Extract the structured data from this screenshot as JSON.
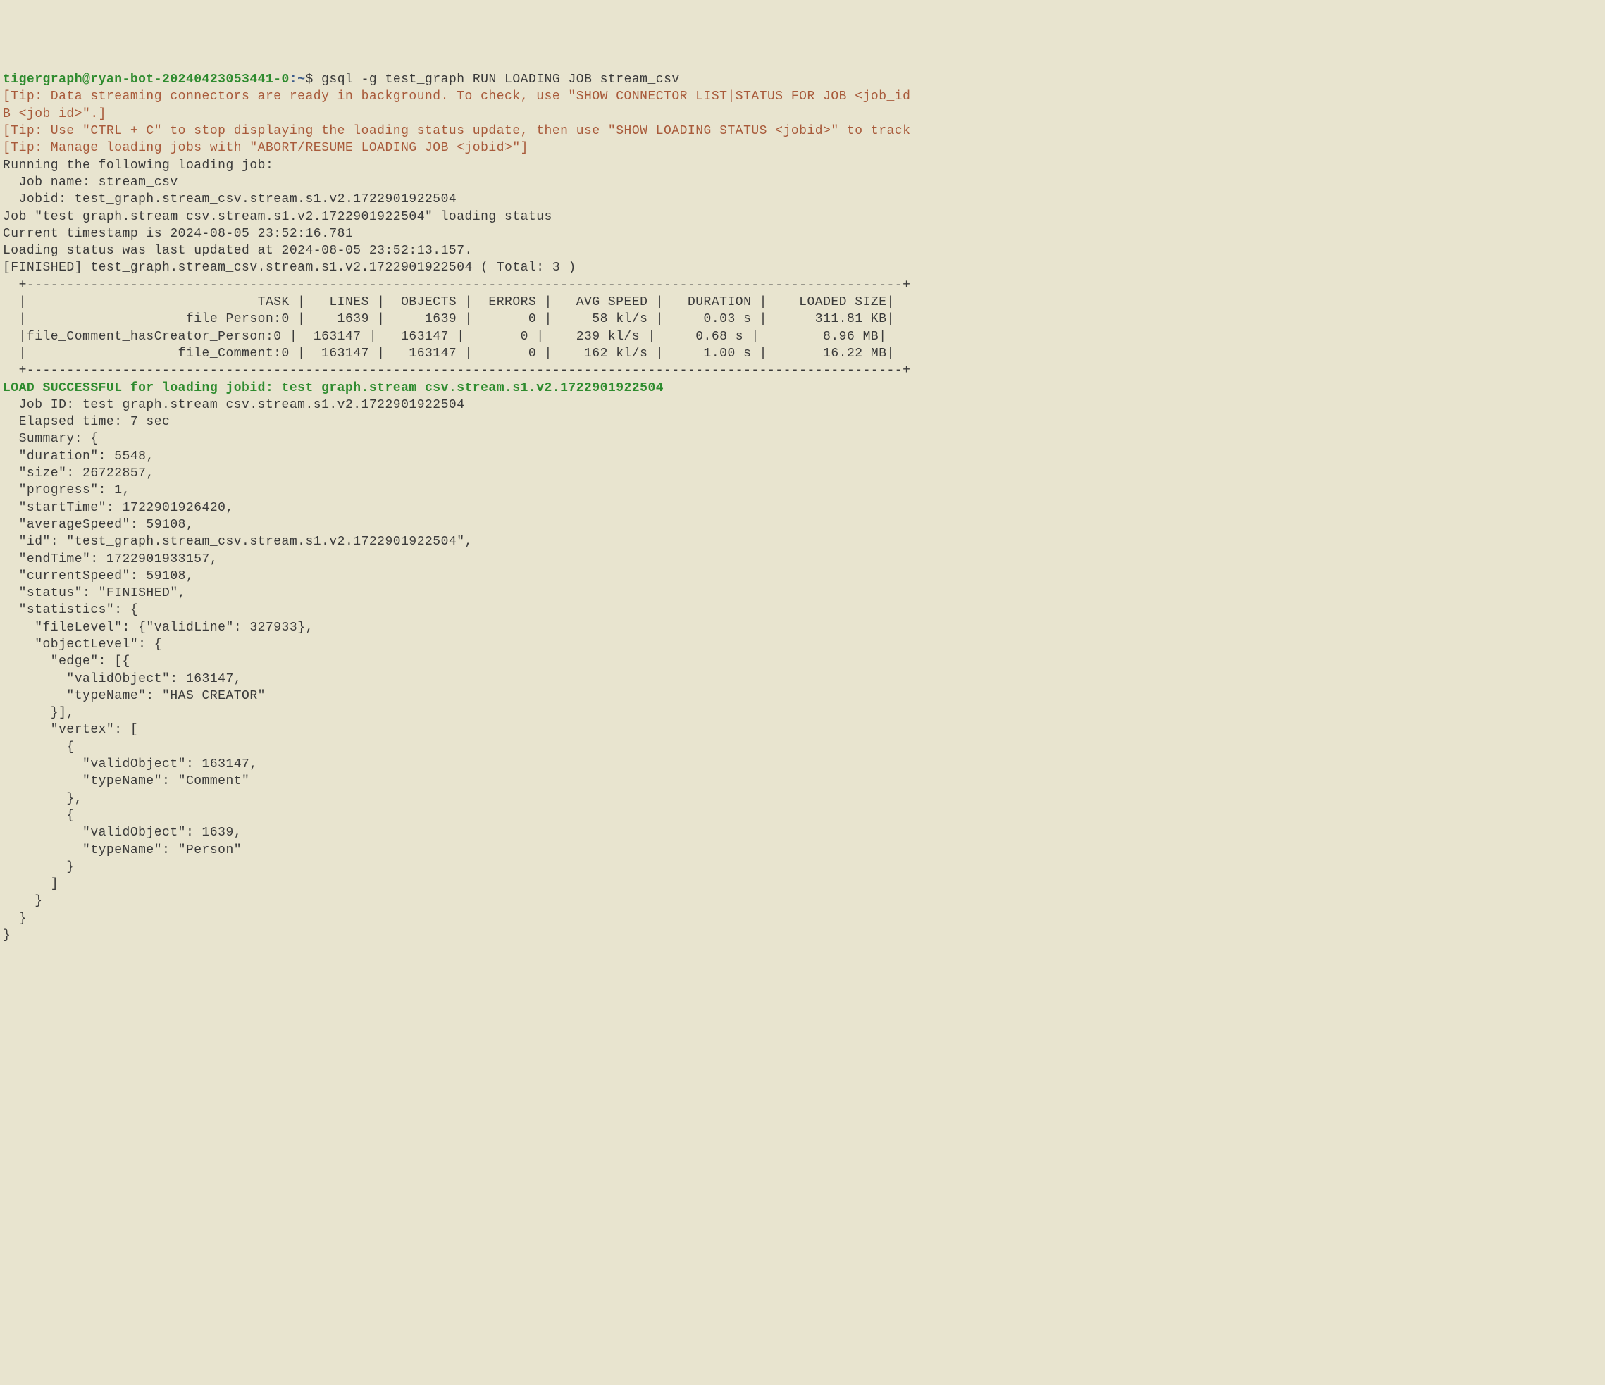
{
  "prompt": {
    "user": "tigergraph@ryan-bot-20240423053441-0",
    "separator": ":",
    "path": "~",
    "dollar": "$ "
  },
  "command": "gsql -g test_graph RUN LOADING JOB stream_csv",
  "tips": {
    "line1": "[Tip: Data streaming connectors are ready in background. To check, use \"SHOW CONNECTOR LIST|STATUS FOR JOB <job_id",
    "line2": "B <job_id>\".]",
    "line3": "[Tip: Use \"CTRL + C\" to stop displaying the loading status update, then use \"SHOW LOADING STATUS <jobid>\" to track",
    "line4": "[Tip: Manage loading jobs with \"ABORT/RESUME LOADING JOB <jobid>\"]"
  },
  "running": {
    "header": "Running the following loading job:",
    "jobname": "  Job name: stream_csv",
    "jobid": "  Jobid: test_graph.stream_csv.stream.s1.v2.1722901922504",
    "status": "Job \"test_graph.stream_csv.stream.s1.v2.1722901922504\" loading status",
    "timestamp": "Current timestamp is 2024-08-05 23:52:16.781",
    "updated": "Loading status was last updated at 2024-08-05 23:52:13.157.",
    "finished": "[FINISHED] test_graph.stream_csv.stream.s1.v2.1722901922504 ( Total: 3 )"
  },
  "table": {
    "border_top": "  +--------------------------------------------------------------------------------------------------------------+",
    "header": "  |                             TASK |   LINES |  OBJECTS |  ERRORS |   AVG SPEED |   DURATION |    LOADED SIZE|",
    "row1": "  |                    file_Person:0 |    1639 |     1639 |       0 |     58 kl/s |     0.03 s |      311.81 KB|",
    "row2": "  |file_Comment_hasCreator_Person:0 |  163147 |   163147 |       0 |    239 kl/s |     0.68 s |        8.96 MB|",
    "row3": "  |                   file_Comment:0 |  163147 |   163147 |       0 |    162 kl/s |     1.00 s |       16.22 MB|",
    "border_bottom": "  +--------------------------------------------------------------------------------------------------------------+"
  },
  "success_msg": "LOAD SUCCESSFUL for loading jobid: test_graph.stream_csv.stream.s1.v2.1722901922504",
  "details": {
    "jobid": "  Job ID: test_graph.stream_csv.stream.s1.v2.1722901922504",
    "elapsed": "  Elapsed time: 7 sec",
    "summary_open": "  Summary: {",
    "duration": "  \"duration\": 5548,",
    "size": "  \"size\": 26722857,",
    "progress": "  \"progress\": 1,",
    "startTime": "  \"startTime\": 1722901926420,",
    "averageSpeed": "  \"averageSpeed\": 59108,",
    "id": "  \"id\": \"test_graph.stream_csv.stream.s1.v2.1722901922504\",",
    "endTime": "  \"endTime\": 1722901933157,",
    "currentSpeed": "  \"currentSpeed\": 59108,",
    "status": "  \"status\": \"FINISHED\",",
    "stats_open": "  \"statistics\": {",
    "fileLevel": "    \"fileLevel\": {\"validLine\": 327933},",
    "objectLevel_open": "    \"objectLevel\": {",
    "edge_open": "      \"edge\": [{",
    "edge_valid": "        \"validObject\": 163147,",
    "edge_type": "        \"typeName\": \"HAS_CREATOR\"",
    "edge_close": "      }],",
    "vertex_open": "      \"vertex\": [",
    "vertex1_open": "        {",
    "vertex1_valid": "          \"validObject\": 163147,",
    "vertex1_type": "          \"typeName\": \"Comment\"",
    "vertex1_close": "        },",
    "vertex2_open": "        {",
    "vertex2_valid": "          \"validObject\": 1639,",
    "vertex2_type": "          \"typeName\": \"Person\"",
    "vertex2_close": "        }",
    "vertex_close": "      ]",
    "objectLevel_close": "    }",
    "stats_close": "  }",
    "summary_close": "}"
  }
}
